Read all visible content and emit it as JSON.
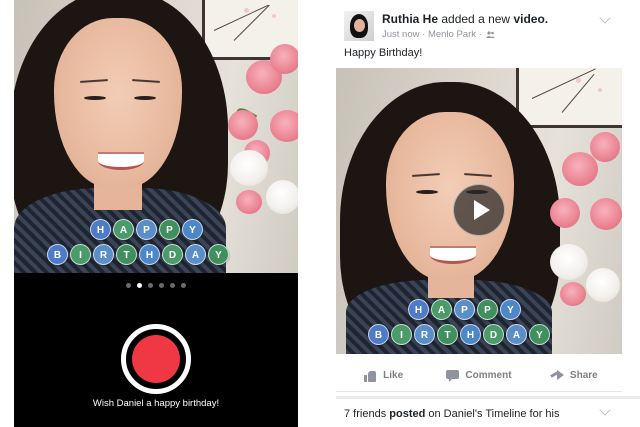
{
  "camera": {
    "caption": "Wish Daniel a happy birthday!",
    "page_dots": 6,
    "active_dot": 1,
    "record_color": "#ef3844"
  },
  "overlay": {
    "row1": [
      "H",
      "A",
      "P",
      "P",
      "Y"
    ],
    "row2": [
      "B",
      "I",
      "R",
      "T",
      "H",
      "D",
      "A",
      "Y"
    ],
    "bubble_colors": [
      "#4d7bc8",
      "#4a9a6a",
      "#5a8ec9",
      "#3f8f5f",
      "#4d86c9",
      "#4a9a6a",
      "#5a8ec9",
      "#3f8f5f"
    ]
  },
  "post": {
    "author": "Ruthia He",
    "action": "added a new",
    "object": "video.",
    "time": "Just now",
    "location": "Menlo Park",
    "separator": "·",
    "text": "Happy Birthday!",
    "privacy_icon": "friends-icon",
    "actions": [
      {
        "label": "Like",
        "icon": "like-icon"
      },
      {
        "label": "Comment",
        "icon": "comment-icon"
      },
      {
        "label": "Share",
        "icon": "share-icon"
      }
    ]
  },
  "story": {
    "prefix": "7 friends",
    "verb": "posted",
    "suffix": "on Daniel's Timeline for his"
  }
}
